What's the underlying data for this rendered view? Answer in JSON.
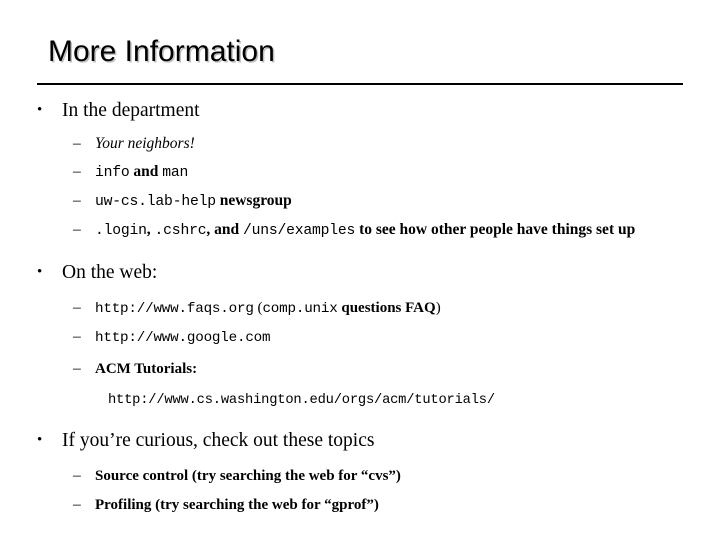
{
  "slide": {
    "title": "More Information",
    "background_color": "#ffffff",
    "text_color": "#000000",
    "title_shadow_color": "#8c8c8c",
    "rule_color": "#000000"
  },
  "markers": {
    "bullet": "•",
    "dash": "–"
  },
  "sections": [
    {
      "heading": "In the department",
      "items": [
        {
          "id": "your-neighbors",
          "parts": [
            {
              "style": "italic",
              "text": "Your neighbors!"
            }
          ]
        },
        {
          "id": "info-and-man",
          "parts": [
            {
              "style": "mono",
              "text": "info"
            },
            {
              "style": "bold",
              "text": " and "
            },
            {
              "style": "mono",
              "text": "man"
            }
          ]
        },
        {
          "id": "lab-help-newsgroup",
          "parts": [
            {
              "style": "mono",
              "text": "uw-cs.lab-help"
            },
            {
              "style": "bold",
              "text": " newsgroup"
            }
          ]
        },
        {
          "id": "dotfiles-and-examples",
          "parts": [
            {
              "style": "mono",
              "text": ".login"
            },
            {
              "style": "bold",
              "text": ", "
            },
            {
              "style": "mono",
              "text": ".cshrc"
            },
            {
              "style": "bold",
              "text": ", and "
            },
            {
              "style": "mono",
              "text": "/uns/examples"
            },
            {
              "style": "bold",
              "text": " to see how other people have things set up"
            }
          ]
        }
      ]
    },
    {
      "heading": "On the web:",
      "items": [
        {
          "id": "faqs-org",
          "parts": [
            {
              "style": "mono",
              "text": "http://www.faqs.org"
            },
            {
              "style": "regular",
              "text": " ("
            },
            {
              "style": "mono",
              "text": "comp.unix"
            },
            {
              "style": "bold",
              "text": " questions FAQ"
            },
            {
              "style": "regular",
              "text": ")"
            }
          ]
        },
        {
          "id": "google",
          "parts": [
            {
              "style": "mono",
              "text": "http://www.google.com"
            }
          ]
        },
        {
          "id": "acm-tutorials",
          "parts": [
            {
              "style": "bold",
              "text": "ACM Tutorials:"
            }
          ],
          "sub_line": {
            "style": "mono",
            "text": "http://www.cs.washington.edu/orgs/acm/tutorials/"
          }
        }
      ]
    },
    {
      "heading": "If you’re curious, check out these topics",
      "items": [
        {
          "id": "source-control",
          "parts": [
            {
              "style": "bold",
              "text": "Source control (try searching the web for “cvs”)"
            }
          ]
        },
        {
          "id": "profiling",
          "parts": [
            {
              "style": "bold",
              "text": "Profiling (try searching the web for “gprof”)"
            }
          ]
        }
      ]
    }
  ]
}
